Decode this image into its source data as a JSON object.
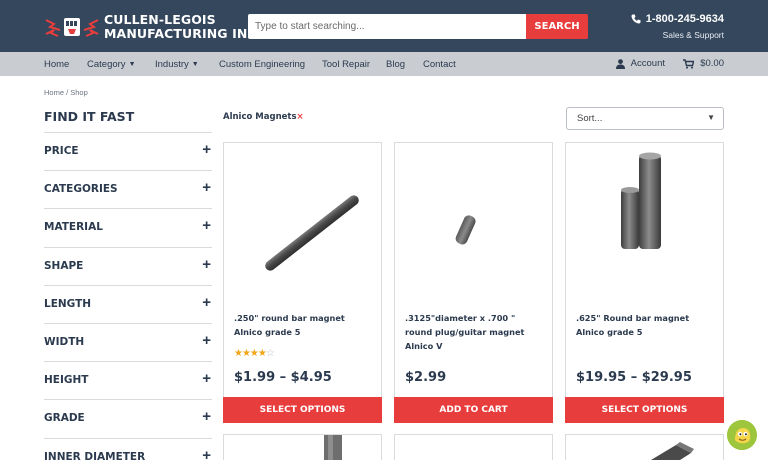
{
  "header": {
    "logo_line1": "CULLEN-LEGOIS",
    "logo_line2": "MANUFACTURING INC.",
    "search_placeholder": "Type to start searching...",
    "search_button": "SEARCH",
    "phone": "1-800-245-9634",
    "phone_sub": "Sales & Support"
  },
  "nav": {
    "items": [
      "Home",
      "Category",
      "Industry",
      "Custom Engineering",
      "Tool Repair",
      "Blog",
      "Contact"
    ],
    "account": "Account",
    "cart_total": "$0.00"
  },
  "breadcrumb": "Home / Shop",
  "sidebar": {
    "title": "FIND IT FAST",
    "filters": [
      "PRICE",
      "CATEGORIES",
      "MATERIAL",
      "SHAPE",
      "LENGTH",
      "WIDTH",
      "HEIGHT",
      "GRADE",
      "INNER DIAMETER"
    ]
  },
  "active_filter": {
    "label": "Alnico Magnets",
    "remove": "×"
  },
  "sort": {
    "selected": "Sort..."
  },
  "products": [
    {
      "title": ".250\" round bar magnet Alnico grade 5",
      "rating": 4,
      "price": "$1.99 – $4.95",
      "button": "SELECT OPTIONS"
    },
    {
      "title": ".3125\"diameter x .700 \" round plug/guitar magnet Alnico V",
      "price": "$2.99",
      "button": "ADD TO CART"
    },
    {
      "title": ".625\" Round bar magnet Alnico grade 5",
      "price": "$19.95 – $29.95",
      "button": "SELECT OPTIONS"
    }
  ],
  "colors": {
    "header_bg": "#34475d",
    "nav_bg": "#c9cdd2",
    "accent_red": "#e83d3d",
    "star": "#f2a51a"
  }
}
